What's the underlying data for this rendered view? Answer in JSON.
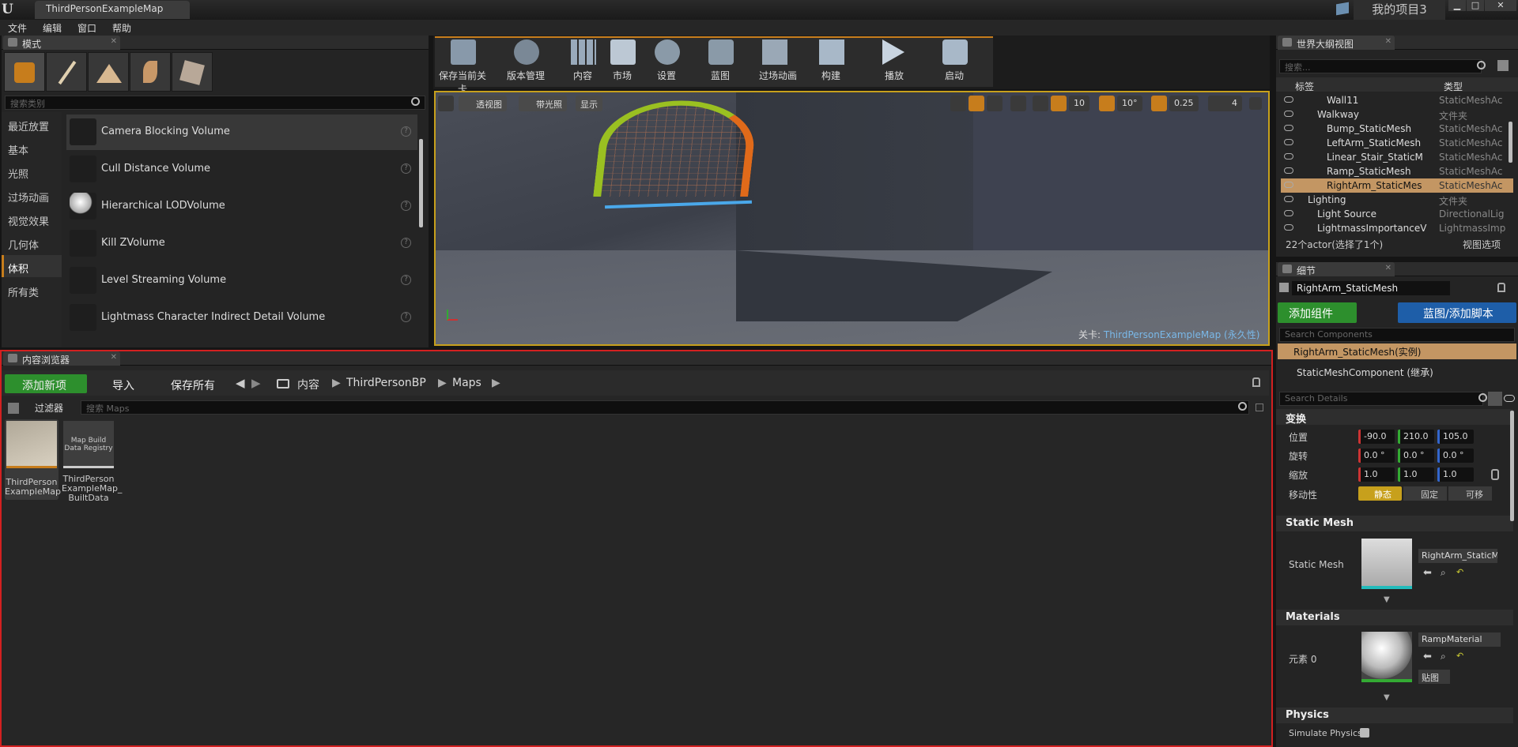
{
  "window": {
    "map_tab": "ThirdPersonExampleMap",
    "project_name": "我的项目3",
    "minimize": "▁",
    "maximize": "□",
    "close": "✕"
  },
  "menu": [
    "文件",
    "编辑",
    "窗口",
    "帮助"
  ],
  "modes_panel": {
    "tab_label": "模式",
    "search_placeholder": "搜索类别",
    "categories": [
      "最近放置",
      "基本",
      "光照",
      "过场动画",
      "视觉效果",
      "几何体",
      "体积",
      "所有类"
    ],
    "selected_category": "体积",
    "volumes": [
      "Camera Blocking Volume",
      "Cull Distance Volume",
      "Hierarchical LODVolume",
      "Kill ZVolume",
      "Level Streaming Volume",
      "Lightmass Character Indirect Detail Volume"
    ]
  },
  "toolbar": [
    "保存当前关卡",
    "版本管理",
    "内容",
    "市场",
    "设置",
    "蓝图",
    "过场动画",
    "构建",
    "播放",
    "启动"
  ],
  "viewport": {
    "view_mode": "透视图",
    "lit_mode": "带光照",
    "show": "显示",
    "grid_snap": "10",
    "rotation_snap": "10°",
    "scale_snap": "0.25",
    "camera_speed": "4",
    "level_label": "关卡:",
    "level_name": "ThirdPersonExampleMap",
    "level_suffix": "(永久性)"
  },
  "content_browser": {
    "tab_label": "内容浏览器",
    "add_new": "添加新项",
    "import": "导入",
    "save_all": "保存所有",
    "breadcrumb": [
      "内容",
      "ThirdPersonBP",
      "Maps"
    ],
    "filters": "过滤器",
    "search_placeholder": "搜索 Maps",
    "assets": [
      {
        "label": "ThirdPerson ExampleMap",
        "thumb_text": ""
      },
      {
        "label": "ThirdPerson ExampleMap_ BuiltData",
        "thumb_text": "Map Build Data Registry"
      }
    ]
  },
  "outliner": {
    "tab_label": "世界大纲视图",
    "search_placeholder": "搜索...",
    "col_label": "标签",
    "col_type": "类型",
    "rows": [
      {
        "name": "Wall11",
        "type": "StaticMeshAc",
        "indent": 4,
        "selected": false
      },
      {
        "name": "Walkway",
        "type": "文件夹",
        "indent": 3,
        "selected": false
      },
      {
        "name": "Bump_StaticMesh",
        "type": "StaticMeshAc",
        "indent": 4,
        "selected": false
      },
      {
        "name": "LeftArm_StaticMesh",
        "type": "StaticMeshAc",
        "indent": 4,
        "selected": false
      },
      {
        "name": "Linear_Stair_StaticM",
        "type": "StaticMeshAc",
        "indent": 4,
        "selected": false
      },
      {
        "name": "Ramp_StaticMesh",
        "type": "StaticMeshAc",
        "indent": 4,
        "selected": false
      },
      {
        "name": "RightArm_StaticMes",
        "type": "StaticMeshAc",
        "indent": 4,
        "selected": true
      },
      {
        "name": "Lighting",
        "type": "文件夹",
        "indent": 2,
        "selected": false
      },
      {
        "name": "Light Source",
        "type": "DirectionalLig",
        "indent": 3,
        "selected": false
      },
      {
        "name": "LightmassImportanceV",
        "type": "LightmassImp",
        "indent": 3,
        "selected": false
      }
    ],
    "status": "22个actor(选择了1个)",
    "view_options": "视图选项"
  },
  "details": {
    "tab_label": "细节",
    "actor_name": "RightArm_StaticMesh",
    "add_component": "添加组件",
    "blueprint_script": "蓝图/添加脚本",
    "search_components": "Search Components",
    "root_component": "RightArm_StaticMesh(实例)",
    "child_component": "StaticMeshComponent (继承)",
    "search_details": "Search Details",
    "transform_section": "变换",
    "location_label": "位置",
    "rotation_label": "旋转",
    "scale_label": "缩放",
    "mobility_label": "移动性",
    "location": [
      "-90.0",
      "210.0",
      "105.0"
    ],
    "rotation": [
      "0.0 °",
      "0.0 °",
      "0.0 °"
    ],
    "scale": [
      "1.0",
      "1.0",
      "1.0"
    ],
    "mobility": [
      "静态",
      "固定",
      "可移"
    ],
    "static_mesh_section": "Static Mesh",
    "static_mesh_label": "Static Mesh",
    "static_mesh_value": "RightArm_StaticM",
    "materials_section": "Materials",
    "element_label": "元素 0",
    "material_value": "RampMaterial",
    "textures_btn": "贴图",
    "physics_section": "Physics",
    "simulate_physics": "Simulate Physics"
  },
  "colors": {
    "accent_orange": "#c77d1c",
    "selection": "#c39663",
    "add_green": "#2d8f2d",
    "blue_btn": "#1e5ea8",
    "red_border": "#d32020"
  }
}
